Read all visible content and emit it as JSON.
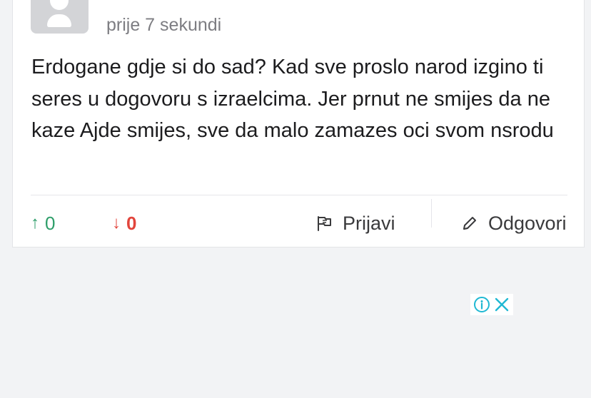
{
  "comment": {
    "timestamp": "prije 7 sekundi",
    "text": "Erdogane gdje si do sad? Kad sve proslo narod izgino ti seres u dogovoru s izraelcima. Jer prnut ne smijes da ne kaze Ajde smijes, sve da malo zamazes oci svom nsrodu",
    "upvotes": "0",
    "downvotes": "0",
    "upvote_icon": "arrow-up-icon",
    "downvote_icon": "arrow-down-icon",
    "report_label": "Prijavi",
    "report_icon": "flag-icon",
    "reply_label": "Odgovori",
    "reply_icon": "pencil-icon"
  },
  "ad": {
    "info_icon": "info-icon",
    "close_icon": "close-icon",
    "accent_color": "#1fb8d3"
  },
  "colors": {
    "upvote": "#2e9e6a",
    "downvote": "#e2453c"
  }
}
